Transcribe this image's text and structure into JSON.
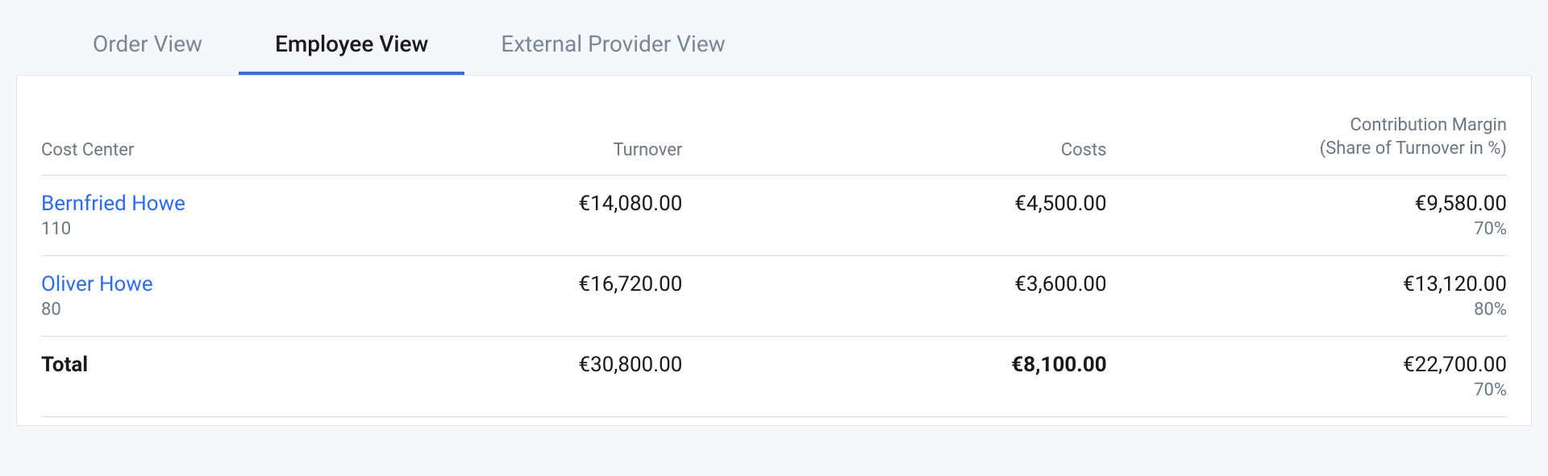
{
  "tabs": {
    "order": "Order View",
    "employee": "Employee View",
    "external": "External Provider View"
  },
  "table": {
    "headers": {
      "cost_center": "Cost Center",
      "turnover": "Turnover",
      "costs": "Costs",
      "margin_line1": "Contribution Margin",
      "margin_line2": "(Share of Turnover in %)"
    },
    "rows": [
      {
        "name": "Bernfried Howe",
        "code": "110",
        "turnover": "€14,080.00",
        "costs": "€4,500.00",
        "margin": "€9,580.00",
        "share": "70%"
      },
      {
        "name": "Oliver Howe",
        "code": "80",
        "turnover": "€16,720.00",
        "costs": "€3,600.00",
        "margin": "€13,120.00",
        "share": "80%"
      }
    ],
    "total": {
      "label": "Total",
      "turnover": "€30,800.00",
      "costs": "€8,100.00",
      "margin": "€22,700.00",
      "share": "70%"
    }
  }
}
